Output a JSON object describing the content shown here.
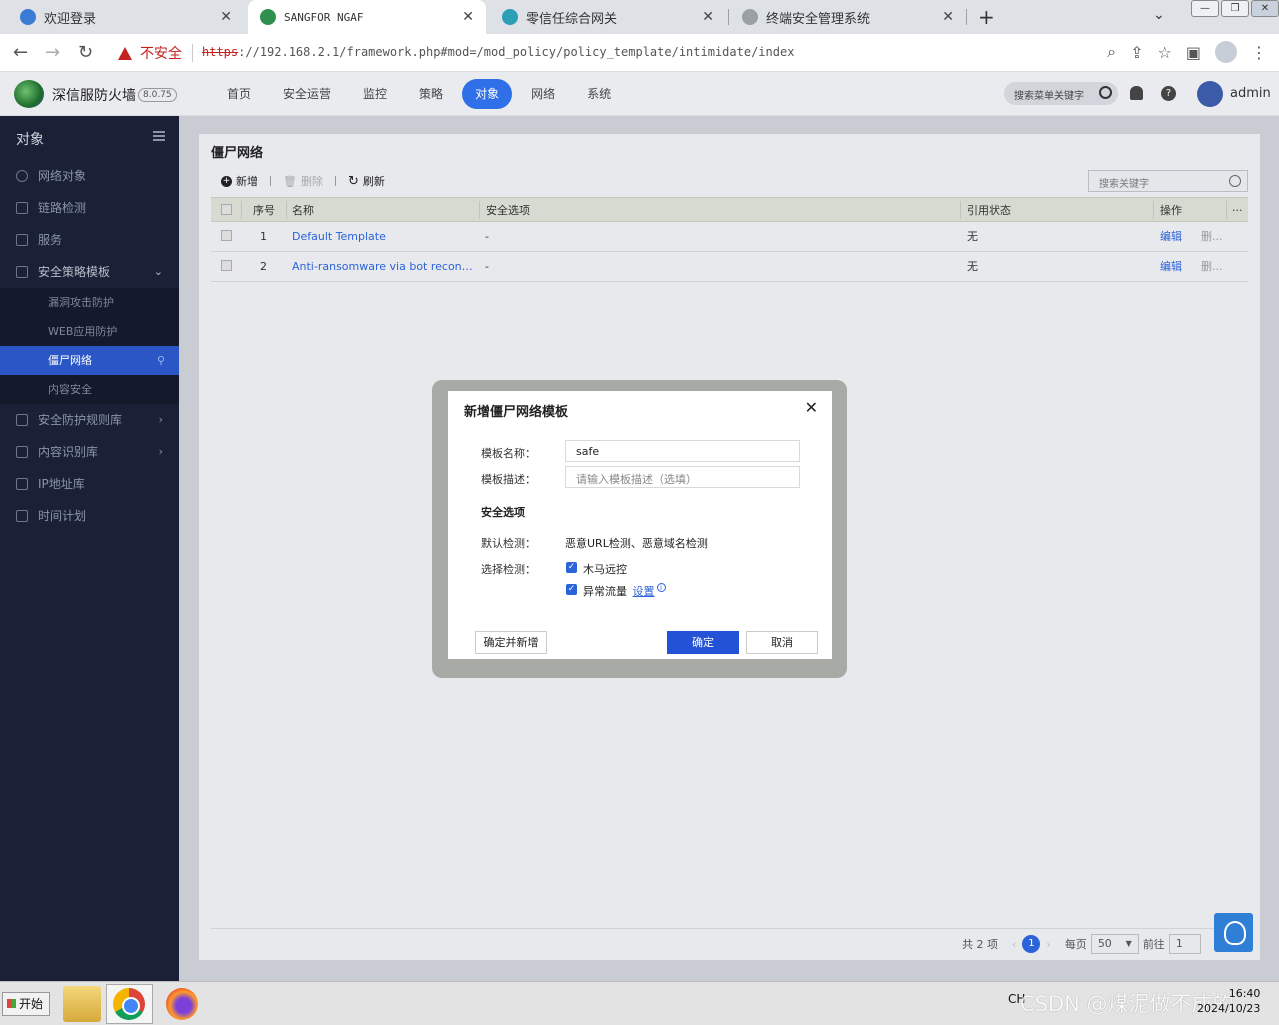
{
  "browser": {
    "tabs": [
      {
        "title": "欢迎登录"
      },
      {
        "title": "SANGFOR NGAF"
      },
      {
        "title": "零信任综合网关"
      },
      {
        "title": "终端安全管理系统"
      }
    ],
    "security_warning": "不安全",
    "url_scheme": "https",
    "url_rest": "://192.168.2.1/framework.php#mod=/mod_policy/policy_template/intimidate/index"
  },
  "app": {
    "brand": "深信服防火墙",
    "version": "8.0.75",
    "nav": [
      "首页",
      "安全运营",
      "监控",
      "策略",
      "对象",
      "网络",
      "系统"
    ],
    "active_nav": "对象",
    "menu_search_placeholder": "搜索菜单关键字",
    "user": "admin"
  },
  "sidebar": {
    "title": "对象",
    "items": [
      {
        "label": "网络对象"
      },
      {
        "label": "链路检测"
      },
      {
        "label": "服务"
      },
      {
        "label": "安全策略模板"
      },
      {
        "label": "安全防护规则库"
      },
      {
        "label": "内容识别库"
      },
      {
        "label": "IP地址库"
      },
      {
        "label": "时间计划"
      }
    ],
    "subitems": [
      {
        "label": "漏洞攻击防护"
      },
      {
        "label": "WEB应用防护"
      },
      {
        "label": "僵尸网络"
      },
      {
        "label": "内容安全"
      }
    ]
  },
  "page": {
    "title": "僵尸网络",
    "toolbar": {
      "add": "新增",
      "delete": "删除",
      "refresh": "刷新"
    },
    "search_placeholder": "搜索关键字",
    "columns": [
      "序号",
      "名称",
      "安全选项",
      "引用状态",
      "操作"
    ],
    "rows": [
      {
        "no": "1",
        "name": "Default Template",
        "options": "-",
        "ref": "无",
        "edit": "编辑",
        "del": "删..."
      },
      {
        "no": "2",
        "name": "Anti-ransomware via bot reconnect...",
        "options": "-",
        "ref": "无",
        "edit": "编辑",
        "del": "删..."
      }
    ],
    "pager": {
      "total": "共 2 项",
      "current": "1",
      "per_page_label": "每页",
      "per_page": "50",
      "goto_label": "前往",
      "goto": "1"
    }
  },
  "modal": {
    "title": "新增僵尸网络模板",
    "name_label": "模板名称：",
    "name_value": "safe",
    "desc_label": "模板描述：",
    "desc_placeholder": "请输入模板描述（选填）",
    "section": "安全选项",
    "default_label": "默认检测：",
    "default_value": "恶意URL检测、恶意域名检测",
    "select_label": "选择检测：",
    "option1": "木马远控",
    "option2": "异常流量",
    "settings_link": "设置",
    "btn_confirm_add": "确定并新增",
    "btn_ok": "确定",
    "btn_cancel": "取消"
  },
  "taskbar": {
    "start": "开始",
    "tray_text": "CH",
    "watermark": "CSDN @煤泥做不成的",
    "time": "16:40",
    "date": "2024/10/23"
  }
}
